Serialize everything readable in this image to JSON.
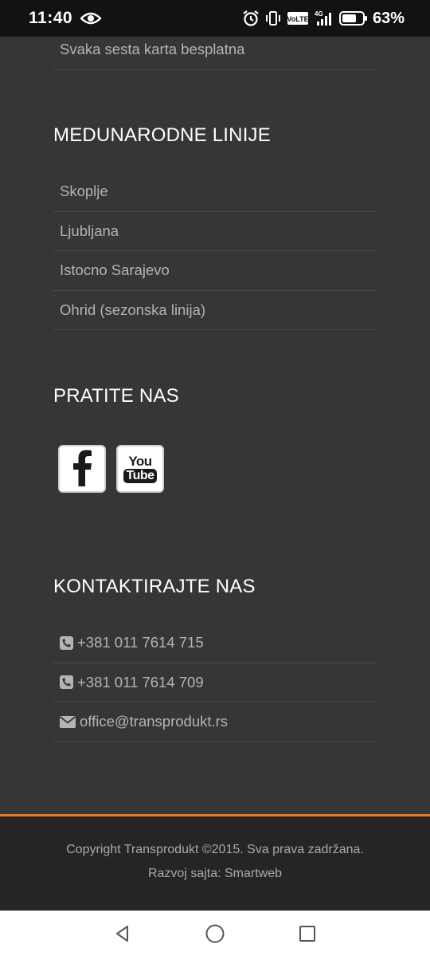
{
  "status_bar": {
    "time": "11:40",
    "battery_percent": "63%",
    "network_label": "4G"
  },
  "promo": {
    "item": "Svaka sesta karta besplatna"
  },
  "international_lines": {
    "heading": "MEDUNARODNE LINIJE",
    "items": [
      "Skoplje",
      "Ljubljana",
      "Istocno Sarajevo",
      "Ohrid (sezonska linija)"
    ]
  },
  "follow_us": {
    "heading": "PRATITE NAS",
    "facebook_icon": "facebook-icon",
    "youtube_label_top": "You",
    "youtube_label_bottom": "Tube"
  },
  "contact": {
    "heading": "KONTAKTIRAJTE NAS",
    "phone1": "+381 011 7614 715",
    "phone2": "+381 011 7614 709",
    "email": "office@transprodukt.rs"
  },
  "footer": {
    "copyright": "Copyright Transprodukt ©2015. Sva prava zadržana.",
    "credits": "Razvoj sajta: Smartweb"
  },
  "colors": {
    "background": "#363636",
    "accent": "#e07b2a",
    "footer_bg": "#252525"
  }
}
